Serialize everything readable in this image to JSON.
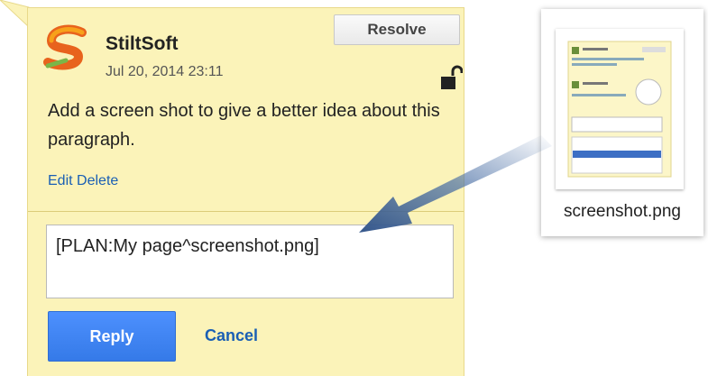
{
  "comment": {
    "author": "StiltSoft",
    "date": "Jul 20, 2014 23:11",
    "resolve_label": "Resolve",
    "text": "Add a screen shot to give a better idea about this paragraph.",
    "edit_label": "Edit",
    "delete_label": "Delete"
  },
  "reply": {
    "input_value": "[PLAN:My page^screenshot.png]",
    "reply_label": "Reply",
    "cancel_label": "Cancel"
  },
  "attachment": {
    "file_name": "screenshot.png"
  },
  "colors": {
    "card_bg": "#fbf3b9",
    "link": "#1a5fb4",
    "primary_button": "#4d90fe",
    "arrow": "#4a6fa5"
  },
  "icons": [
    "stiltsoft-logo",
    "unlock-icon",
    "arrow-icon"
  ]
}
